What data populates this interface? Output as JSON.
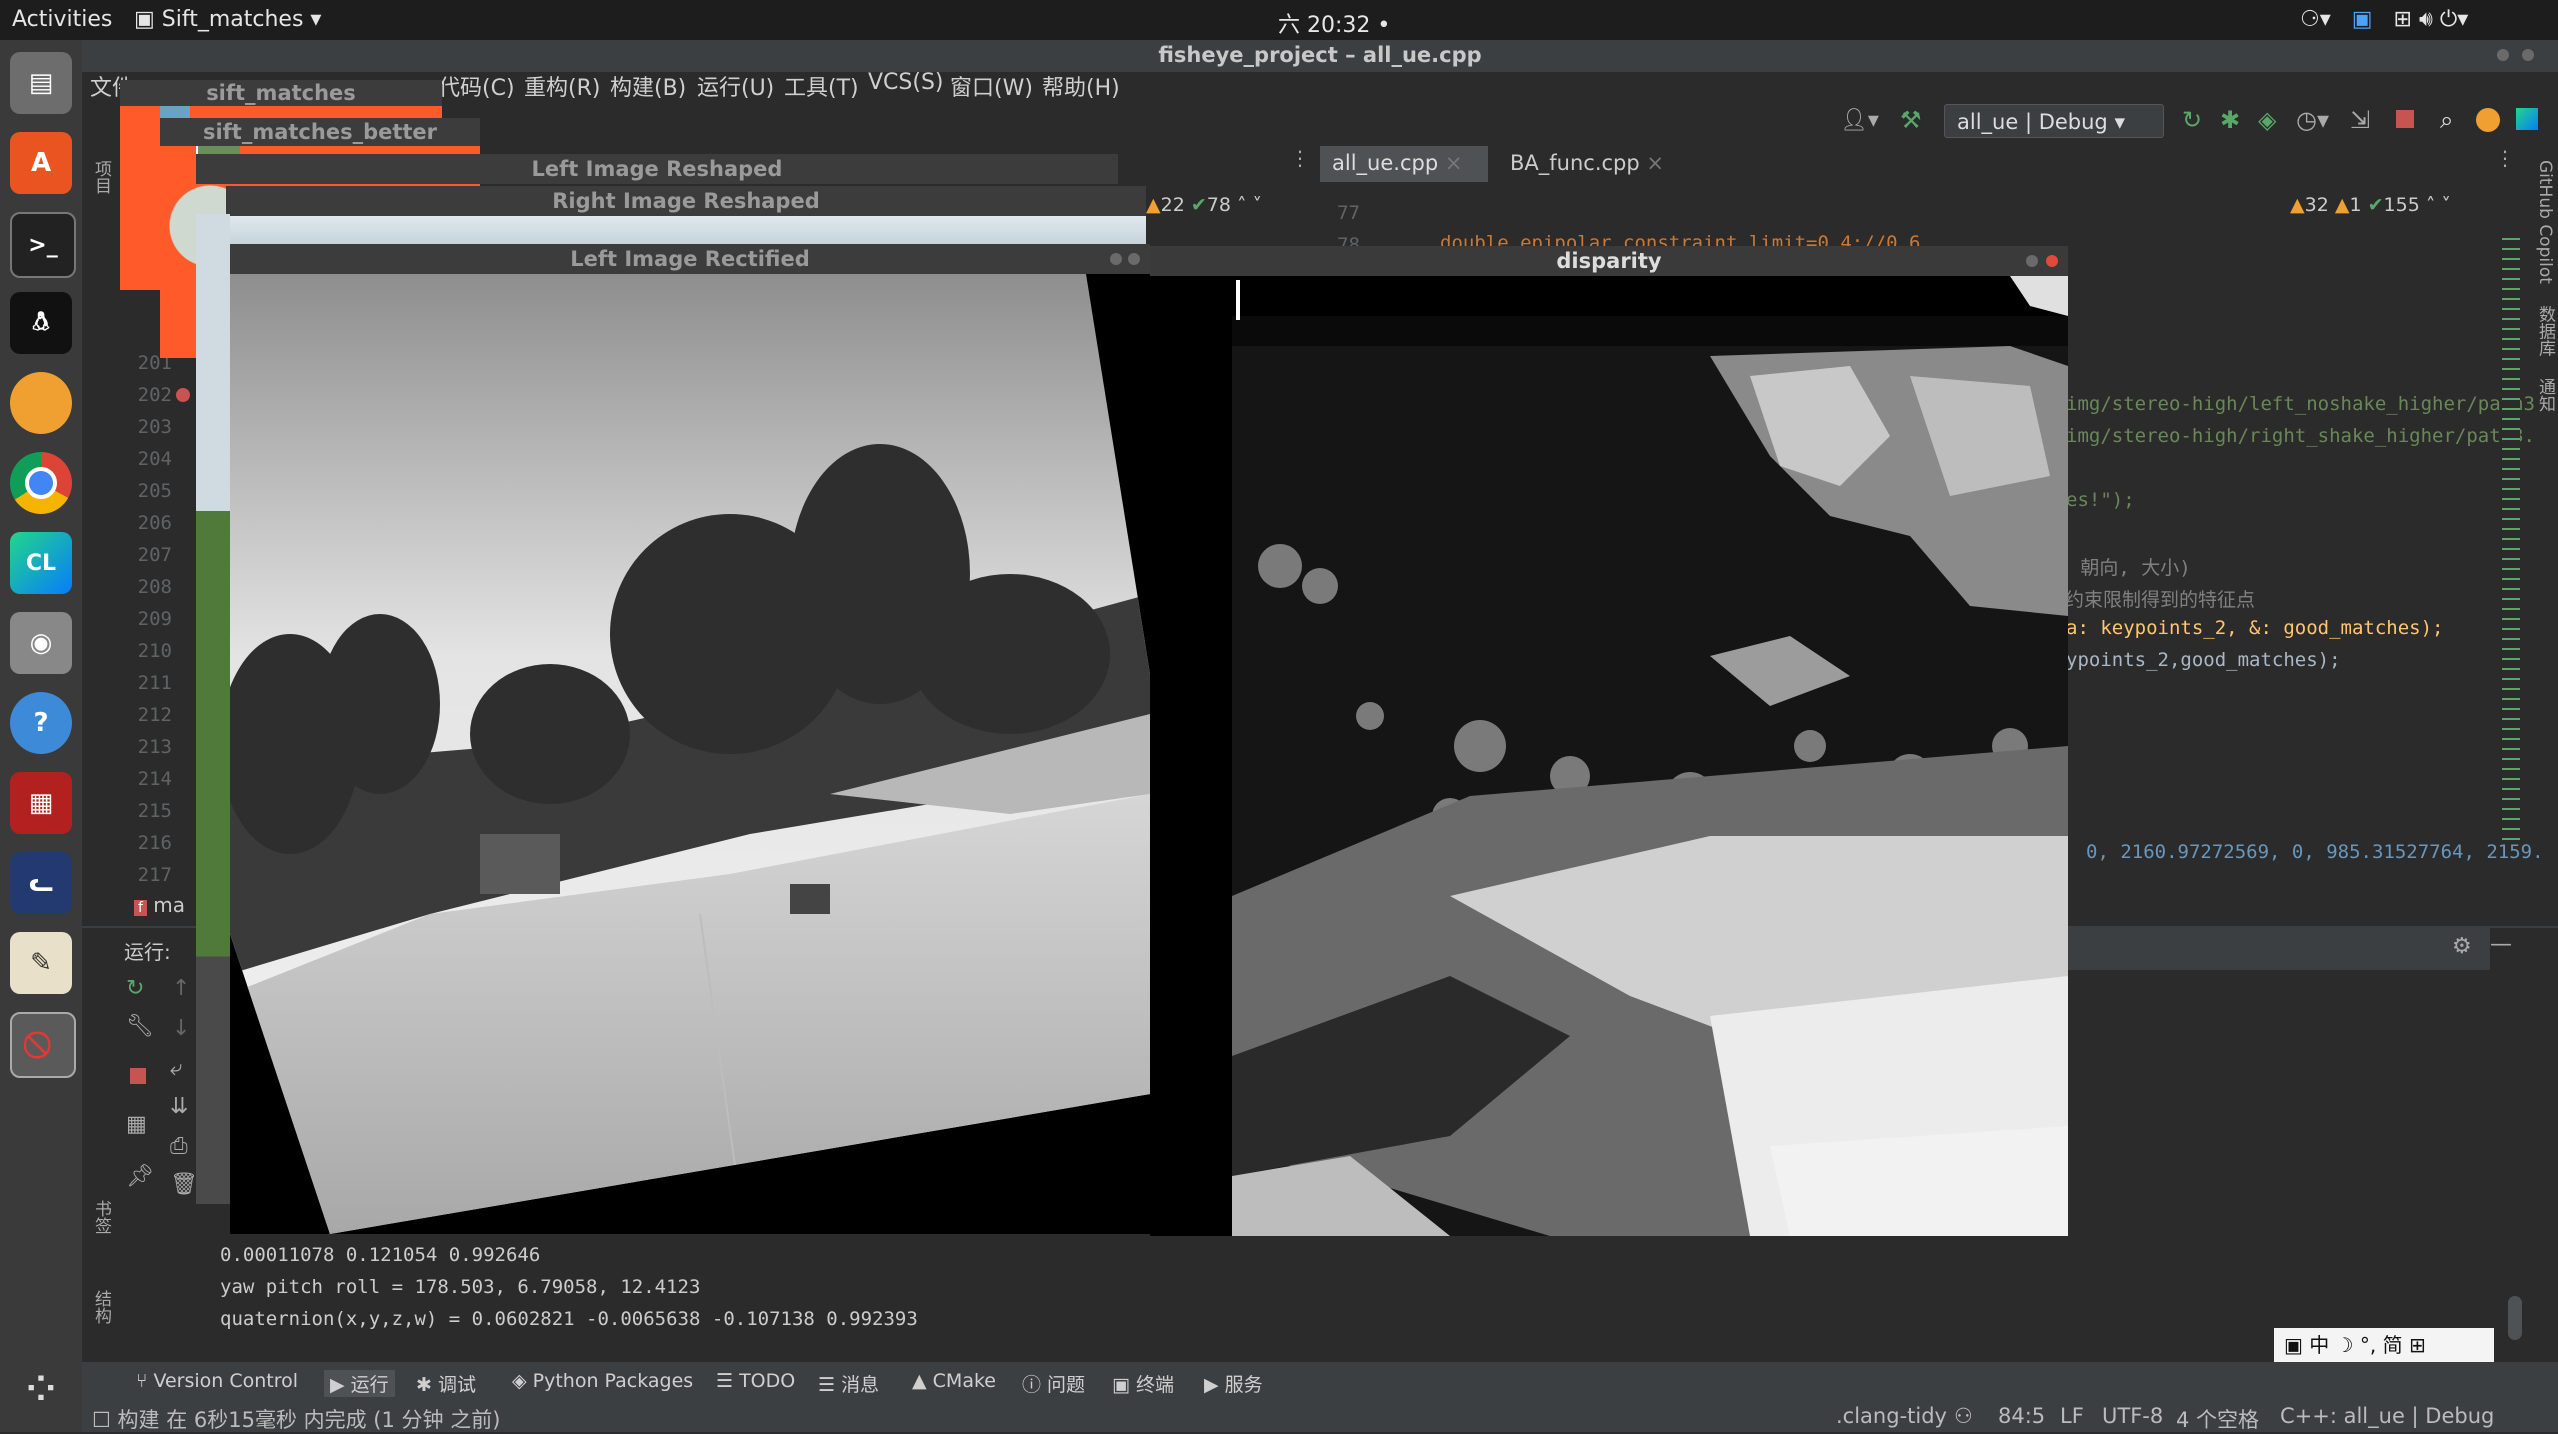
{
  "topbar": {
    "activities": "Activities",
    "app_menu": "Sift_matches",
    "clock": "六 20:32 •"
  },
  "ide": {
    "title": "fisheye_project – all_ue.cpp",
    "menus": [
      "代码(C)",
      "重构(R)",
      "构建(B)",
      "运行(U)",
      "工具(T)",
      "VCS(S)",
      "窗口(W)",
      "帮助(H)"
    ],
    "menu_partial": "文件",
    "run_config": "all_ue | Debug",
    "tabs": [
      "all_ue.cpp",
      "BA_func.cpp"
    ],
    "left_inspection": {
      "warnings": "22",
      "ok": "78"
    },
    "right_inspection": {
      "warn": "32",
      "weak": "1",
      "ok": "155"
    },
    "top_lines": [
      "77",
      "78"
    ],
    "line_numbers": [
      "201",
      "202",
      "203",
      "204",
      "205",
      "206",
      "207",
      "208",
      "209",
      "210",
      "211",
      "212",
      "213",
      "214",
      "215",
      "216",
      "217"
    ],
    "code_top": "double epipolar_constraint_limit=0.4;//0.6",
    "code_right": [
      "img/stereo-high/left_noshake_higher/path3",
      "img/stereo-high/right_shake_higher/path3.",
      "es!\");",
      "), 朝向, 大小)",
      "的约束限制得到的特征点",
      "a: keypoints_2, &: good_matches);",
      "ypoints_2,good_matches);",
      "0, 2160.97272569, 0, 985.31527764, 2159."
    ],
    "file_tab_partial": "ma",
    "run_label": "运行:",
    "console": [
      "0.00011078   0.121054   0.992646",
      "yaw pitch roll = 178.503, 6.79058, 12.4123",
      "quaternion(x,y,z,w) =  0.0602821 -0.0065638  -0.107138   0.992393"
    ],
    "bottom_tabs": [
      "Version Control",
      "运行",
      "调试",
      "Python Packages",
      "TODO",
      "消息",
      "CMake",
      "问题",
      "终端",
      "服务"
    ],
    "status_left": "构建 在 6秒15毫秒 内完成 (1 分钟 之前)",
    "status_right": [
      ".clang-tidy",
      "84:5",
      "LF",
      "UTF-8",
      "4 个空格",
      "C++: all_ue | Debug"
    ],
    "ime": "中  ☽  °,  简  ⊞",
    "side_right": [
      "GitHub Copilot",
      "数据库",
      "通知"
    ],
    "side_left": [
      "项目",
      "书签",
      "结构"
    ]
  },
  "windows": {
    "sift_matches": "sift_matches",
    "sift_matches_better": "sift_matches_better",
    "left_reshaped": "Left Image Reshaped",
    "right_reshaped": "Right Image Reshaped",
    "left_rectified": "Left Image Rectified",
    "disparity": "disparity"
  },
  "colors": {
    "accent_green": "#59a869",
    "red_stop": "#c75450",
    "editor_bg": "#2b2b2b"
  }
}
